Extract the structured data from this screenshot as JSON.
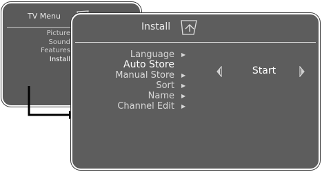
{
  "tv_menu": {
    "title": "TV Menu",
    "items": [
      {
        "label": "Picture"
      },
      {
        "label": "Sound"
      },
      {
        "label": "Features"
      },
      {
        "label": "Install"
      }
    ],
    "active_item": "Install"
  },
  "install": {
    "title": "Install",
    "items": [
      {
        "label": "Language",
        "has_arrow": true
      },
      {
        "label": "Auto Store",
        "has_arrow": false,
        "selected": true
      },
      {
        "label": "Manual Store",
        "has_arrow": true
      },
      {
        "label": "Sort",
        "has_arrow": true
      },
      {
        "label": "Name",
        "has_arrow": true
      },
      {
        "label": "Channel Edit",
        "has_arrow": true
      }
    ],
    "auto_store_value": "Start"
  },
  "icons": {
    "tv_menu_icon": "menu-icon",
    "install_icon": "install-return-icon",
    "left_value_icon": "left-arrow-icon",
    "right_value_icon": "right-arrow-icon",
    "submenu_arrow_icon": "submenu-arrow-icon",
    "connector_icon": "connector-arrow-icon"
  },
  "colors": {
    "panel_bg": "#5d5d5d",
    "panel_border": "#ffffff",
    "text": "#d7d7d7",
    "text_selected": "#ffffff"
  }
}
